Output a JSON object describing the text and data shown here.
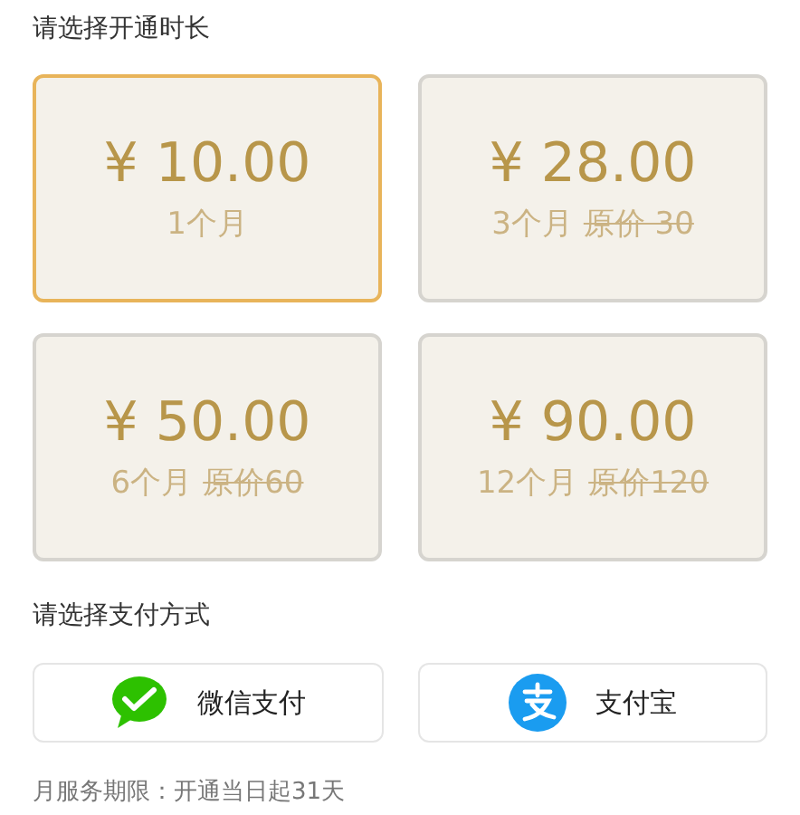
{
  "duration_heading": "请选择开通时长",
  "plans": [
    {
      "price": "¥ 10.00",
      "months": "1个月",
      "selected": true
    },
    {
      "price": "¥ 28.00",
      "months": "3个月",
      "original_price": "原价 30",
      "selected": false
    },
    {
      "price": "¥ 50.00",
      "months": "6个月",
      "original_price": "原价60",
      "selected": false
    },
    {
      "price": "¥ 90.00",
      "months": "12个月",
      "original_price": "原价120",
      "selected": false
    }
  ],
  "payment_heading": "请选择支付方式",
  "payment_methods": [
    {
      "kind": "wechat",
      "label": "微信支付"
    },
    {
      "kind": "alipay",
      "label": "支付宝"
    }
  ],
  "footer_note": "月服务期限：开通当日起31天"
}
